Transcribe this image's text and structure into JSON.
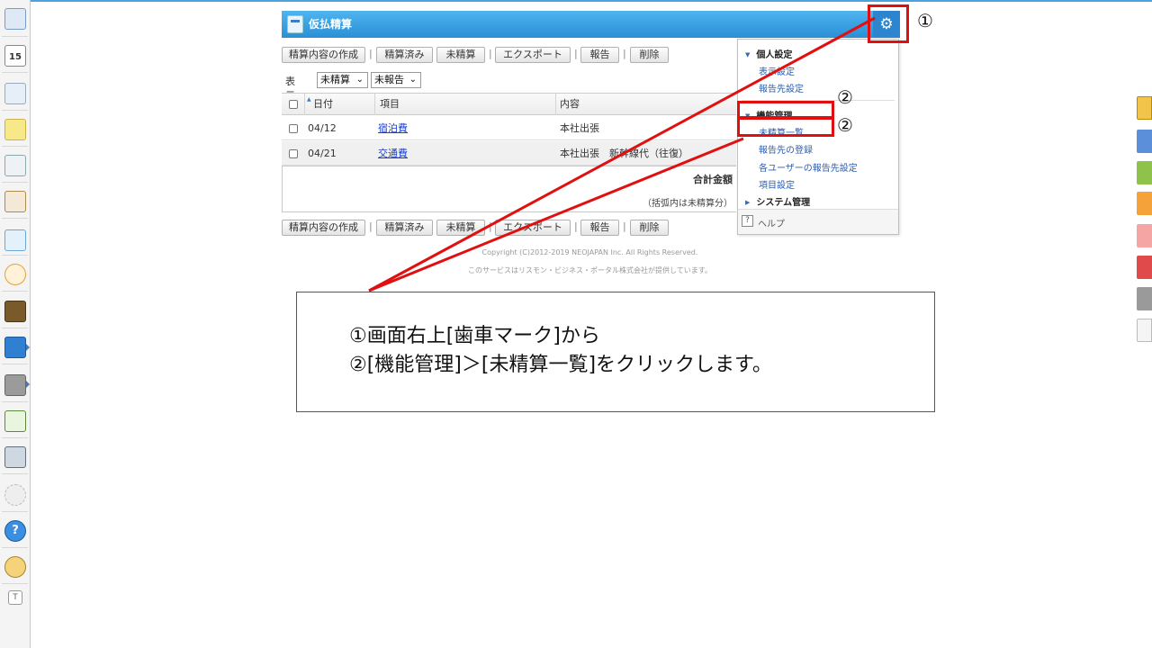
{
  "app": {
    "title": "仮払精算"
  },
  "toolbar": {
    "create": "精算内容の作成",
    "settled": "精算済み",
    "unsettled": "未精算",
    "export": "エクスポート",
    "report": "報告",
    "delete": "削除",
    "separator": "|"
  },
  "filter": {
    "label": "表示：",
    "status_value": "未精算",
    "report_value": "未報告",
    "chevron": "⌄"
  },
  "table": {
    "headers": [
      "日付",
      "項目",
      "内容"
    ],
    "rows": [
      {
        "date": "04/12",
        "item": "宿泊費",
        "content": "本社出張"
      },
      {
        "date": "04/21",
        "item": "交通費",
        "content": "本社出張　新幹線代（往復）"
      }
    ]
  },
  "summary": {
    "total_label": "合計金額",
    "note": "（括弧内は未精算分）"
  },
  "footer": {
    "copyright": "Copyright (C)2012-2019 NEOJAPAN Inc. All Rights Reserved.",
    "provider": "このサービスはリスモン・ビジネス・ポータル株式会社が提供しています。"
  },
  "menu": {
    "personal": {
      "heading": "個人設定",
      "items": [
        "表示設定",
        "報告先設定"
      ]
    },
    "function": {
      "heading": "機能管理",
      "items": [
        "未精算一覧",
        "報告先の登録",
        "各ユーザーの報告先設定",
        "項目設定"
      ]
    },
    "system": {
      "heading": "システム管理"
    },
    "help": {
      "icon": "?",
      "label": "ヘルプ"
    }
  },
  "annotations": {
    "marker1": "①",
    "marker2": "②",
    "callout_line1": "①画面右上[歯車マーク]から",
    "callout_line2": "②[機能管理]＞[未精算一覧]をクリックします。"
  },
  "icons": {
    "gear": "gear-icon",
    "sort_up": "▲",
    "tri_down": "▼",
    "tri_right": "▶"
  },
  "colors": {
    "header_blue": "#2a8fd6",
    "highlight_red": "#e01010",
    "link_blue": "#1a3fd1"
  }
}
